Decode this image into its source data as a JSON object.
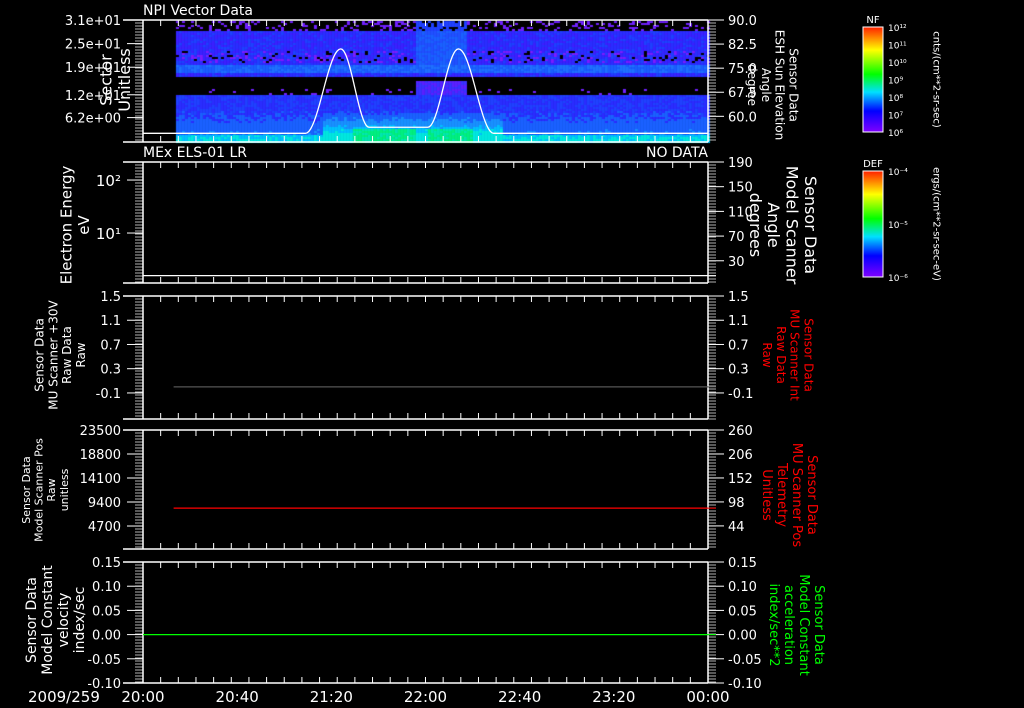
{
  "date_label": "2009/259",
  "time_axis": {
    "start": "20:00",
    "end": "00:00",
    "tick_labels": [
      "20:00",
      "20:40",
      "21:20",
      "22:00",
      "22:40",
      "23:20",
      "00:00"
    ]
  },
  "colors": {
    "axis": "#ffffff",
    "red": "#ff0000",
    "green": "#00ff00",
    "gray": "#555555",
    "background": "#000000"
  },
  "chart_data": [
    {
      "type": "heatmap",
      "title": "NPI Vector Data",
      "ylabel": [
        "Sector",
        "Unitless"
      ],
      "ylim": [
        0,
        31
      ],
      "yticks": [
        31,
        25,
        19,
        12,
        6.2
      ],
      "ytick_labels": [
        "3.1e+01",
        "2.5e+01",
        "1.9e+01",
        "1.2e+01",
        "6.2e+00"
      ],
      "data_start": "20:14",
      "colorbar": {
        "label": "NF",
        "units": "cnts/(cm**2-sr-sec)",
        "tick_labels": [
          "10¹²",
          "10¹¹",
          "10¹⁰",
          "10⁹",
          "10⁸",
          "10⁷",
          "10⁶"
        ]
      },
      "overlay": {
        "type": "line",
        "color": "#ffffff",
        "ylabel": [
          "Sensor Data",
          "ESH Sun Elevation",
          "Angle",
          "degree"
        ],
        "ylim": [
          52,
          90
        ],
        "yticks": [
          90,
          82.5,
          75,
          67.5,
          60
        ],
        "ytick_labels": [
          "90.0",
          "82.5",
          "75.0",
          "67.5",
          "60.0"
        ],
        "x": [
          "20:00",
          "21:09",
          "21:24",
          "21:36",
          "22:01",
          "22:14",
          "22:29",
          "00:00"
        ],
        "y": [
          54.7,
          54.7,
          81,
          56.6,
          56.6,
          81,
          54.7,
          54.7
        ]
      }
    },
    {
      "type": "line",
      "title": "MEx ELS-01 LR",
      "status": "NO DATA",
      "ylabel": [
        "Electron Energy",
        "eV"
      ],
      "yscale": "log",
      "ylim": [
        1.14,
        219
      ],
      "ytick_labels": [
        "10²",
        "10¹"
      ],
      "colorbar": {
        "label": "DEF",
        "units": "ergs/(cm**2-sr-sec-eV)",
        "tick_labels": [
          "10⁻⁴",
          "10⁻⁵",
          "10⁻⁶"
        ]
      },
      "right_axis": {
        "ylabel": [
          "Sensor Data",
          "Model Scanner",
          "Angle",
          "degrees"
        ],
        "ylim": [
          -6,
          190
        ],
        "yticks": [
          190,
          150,
          110,
          70,
          30
        ],
        "ytick_labels": [
          "190",
          "150",
          "110",
          "70",
          "30"
        ]
      },
      "series": [
        {
          "axis": "right",
          "color": "#ffffff",
          "x": [
            "20:00",
            "00:00"
          ],
          "y": [
            6,
            6
          ]
        }
      ]
    },
    {
      "type": "line",
      "ylabel": [
        "Sensor Data",
        "MU Scanner +30V",
        "Raw Data",
        "Raw"
      ],
      "ylim": [
        -0.53,
        1.5
      ],
      "yticks": [
        1.5,
        1.1,
        0.7,
        0.3,
        -0.1
      ],
      "ytick_labels": [
        "1.5",
        "1.1",
        "0.7",
        "0.3",
        "-0.1"
      ],
      "right_axis": {
        "ylabel": [
          "Sensor Data",
          "MU Scanner Int",
          "Raw Data",
          "Raw"
        ],
        "color": "#ff0000",
        "ylim": [
          -0.53,
          1.5
        ],
        "yticks": [
          1.5,
          1.1,
          0.7,
          0.3,
          -0.1
        ],
        "ytick_labels": [
          "1.5",
          "1.1",
          "0.7",
          "0.3",
          "-0.1"
        ]
      },
      "series": [
        {
          "axis": "left",
          "color": "#555555",
          "x": [
            "20:13",
            "00:00"
          ],
          "y": [
            0.0,
            0.0
          ]
        }
      ]
    },
    {
      "type": "line",
      "ylabel": [
        "Sensor Data",
        "Model Scanner Pos",
        "Raw",
        "unitless"
      ],
      "ylim": [
        200,
        23500
      ],
      "yticks": [
        23500,
        18800,
        14100,
        9400,
        4700
      ],
      "ytick_labels": [
        "23500",
        "18800",
        "14100",
        "9400",
        "4700"
      ],
      "right_axis": {
        "ylabel": [
          "Sensor Data",
          "MU Scanner Pos",
          "Telemetry",
          "Unitless"
        ],
        "color": "#ff0000",
        "ylim": [
          -8,
          260
        ],
        "yticks": [
          260,
          206,
          152,
          98,
          44
        ],
        "ytick_labels": [
          "260",
          "206",
          "152",
          "98",
          "44"
        ]
      },
      "series": [
        {
          "axis": "right",
          "color": "#ff0000",
          "x": [
            "20:13",
            "00:00"
          ],
          "y": [
            84,
            84
          ]
        }
      ]
    },
    {
      "type": "line",
      "ylabel": [
        "Sensor Data",
        "Model Constant",
        "velocity",
        "index/sec"
      ],
      "ylim": [
        -0.1,
        0.15
      ],
      "yticks": [
        0.15,
        0.1,
        0.05,
        0.0,
        -0.05,
        -0.1
      ],
      "ytick_labels": [
        "0.15",
        "0.10",
        "0.05",
        "0.00",
        "-0.05",
        "-0.10"
      ],
      "right_axis": {
        "ylabel": [
          "Sensor Data",
          "Model Constant",
          "acceleration",
          "index/sec**2"
        ],
        "color": "#00ff00",
        "ylim": [
          -0.1,
          0.15
        ],
        "yticks": [
          0.15,
          0.1,
          0.05,
          0.0,
          -0.05,
          -0.1
        ],
        "ytick_labels": [
          "0.15",
          "0.10",
          "0.05",
          "0.00",
          "-0.05",
          "-0.10"
        ]
      },
      "series": [
        {
          "axis": "left",
          "color": "#00ff00",
          "x": [
            "20:00",
            "00:00"
          ],
          "y": [
            0,
            0
          ]
        }
      ]
    }
  ]
}
